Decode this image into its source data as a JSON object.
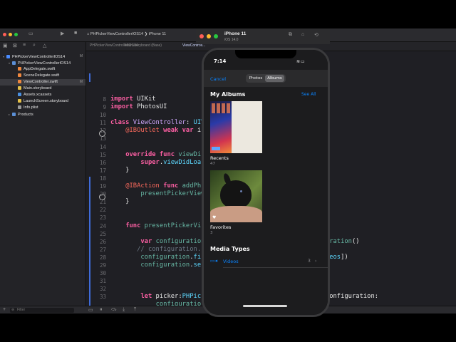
{
  "xcode": {
    "toolbar": {
      "project_breadcrumb": "PHPickerViewControllerIOS14",
      "device": "iPhone 11"
    },
    "tabs": [
      "PHPickerViewControllerIOS14",
      "Main.storyboard (Base)",
      "ViewControll..."
    ],
    "navigator": {
      "items": [
        {
          "label": "PHPickerViewControllerIOS14",
          "badge": "M",
          "level": 0,
          "kind": "project"
        },
        {
          "label": "PHPickerViewControllerIOS14",
          "badge": "",
          "level": 1,
          "kind": "folder"
        },
        {
          "label": "AppDelegate.swift",
          "badge": "",
          "level": 2,
          "kind": "swift"
        },
        {
          "label": "SceneDelegate.swift",
          "badge": "",
          "level": 2,
          "kind": "swift"
        },
        {
          "label": "ViewController.swift",
          "badge": "M",
          "level": 2,
          "kind": "swift",
          "selected": true
        },
        {
          "label": "Main.storyboard",
          "badge": "",
          "level": 2,
          "kind": "storyboard"
        },
        {
          "label": "Assets.xcassets",
          "badge": "",
          "level": 2,
          "kind": "assets"
        },
        {
          "label": "LaunchScreen.storyboard",
          "badge": "",
          "level": 2,
          "kind": "storyboard"
        },
        {
          "label": "Info.plist",
          "badge": "",
          "level": 2,
          "kind": "plist"
        },
        {
          "label": "Products",
          "badge": "",
          "level": 1,
          "kind": "folder"
        }
      ],
      "filter_placeholder": "Filter"
    },
    "code_lines": [
      {
        "n": "8",
        "html": "<span class='kw'>import</span> UIKit"
      },
      {
        "n": "9",
        "html": "<span class='kw'>import</span> PhotosUI"
      },
      {
        "n": "10",
        "html": ""
      },
      {
        "n": "11",
        "html": "<span class='kw'>class</span> <span class='cl'>ViewController</span>: <span class='ty'>UIV</span>"
      },
      {
        "n": "12",
        "html": "    <span class='at'>@IBOutlet</span> <span class='kw'>weak</span> <span class='kw'>var</span> i"
      },
      {
        "n": "13",
        "html": ""
      },
      {
        "n": "14",
        "html": ""
      },
      {
        "n": "15",
        "html": "    <span class='kw'>override</span> <span class='kw'>func</span> <span class='fn'>viewDi</span>"
      },
      {
        "n": "16",
        "html": "        <span class='kw'>super</span>.<span class='ty'>viewDidLoa</span>"
      },
      {
        "n": "17",
        "html": "    }"
      },
      {
        "n": "18",
        "html": ""
      },
      {
        "n": "19",
        "html": "    <span class='at'>@IBAction</span> <span class='kw'>func</span> <span class='fn'>addPh</span>"
      },
      {
        "n": "20",
        "html": "        <span class='fn'>presentPickerView</span>"
      },
      {
        "n": "21",
        "html": "    }"
      },
      {
        "n": "22",
        "html": ""
      },
      {
        "n": "23",
        "html": ""
      },
      {
        "n": "24",
        "html": "    <span class='kw'>func</span> <span class='fn'>presentPickerVi</span>"
      },
      {
        "n": "25",
        "html": ""
      },
      {
        "n": "26",
        "html": "        <span class='kw'>var</span> <span class='fn'>configuration</span>                            <span class='fn'>nfiguration</span>()"
      },
      {
        "n": "27",
        "html": "       <span class='cm'>// configuration.</span>"
      },
      {
        "n": "28",
        "html": "        <span class='fn'>configuration</span>.<span class='ty'>fi</span>                           s, .<span class='ty'>videos</span>])"
      },
      {
        "n": "29",
        "html": "        <span class='fn'>configuration</span>.<span class='ty'>se</span>"
      },
      {
        "n": "30",
        "html": ""
      },
      {
        "n": "31",
        "html": ""
      },
      {
        "n": "32",
        "html": ""
      },
      {
        "n": "33",
        "html": "        <span class='kw'>let</span> picker:<span class='ty'>PHPick</span>                         <span class='ty'>roller</span>(configuration:"
      },
      {
        "n": "",
        "html": "            <span class='fn'>configuratio</span>"
      },
      {
        "n": "34",
        "html": "        picker.<span class='ty'>delegate</span> ="
      },
      {
        "n": "35",
        "html": "        <span class='kw'>self</span>.<span class='ty'>present</span>(pic                           )"
      },
      {
        "n": "36",
        "html": ""
      }
    ]
  },
  "simulator": {
    "device_name": "iPhone 11",
    "os_version": "iOS 14.0",
    "status_time": "7:14",
    "nav": {
      "cancel": "Cancel",
      "segments": [
        "Photos",
        "Albums"
      ],
      "selected_segment": "Albums"
    },
    "my_albums": {
      "title": "My Albums",
      "see_all": "See All",
      "albums": [
        {
          "name": "Recents",
          "count": "47"
        },
        {
          "name": "Favorites",
          "count": "3"
        }
      ]
    },
    "media_types": {
      "title": "Media Types",
      "rows": [
        {
          "label": "Videos",
          "count": "3",
          "icon": "video-icon"
        }
      ]
    }
  },
  "colors": {
    "ios_accent": "#0a84ff",
    "xcode_background": "#1f1f24"
  }
}
